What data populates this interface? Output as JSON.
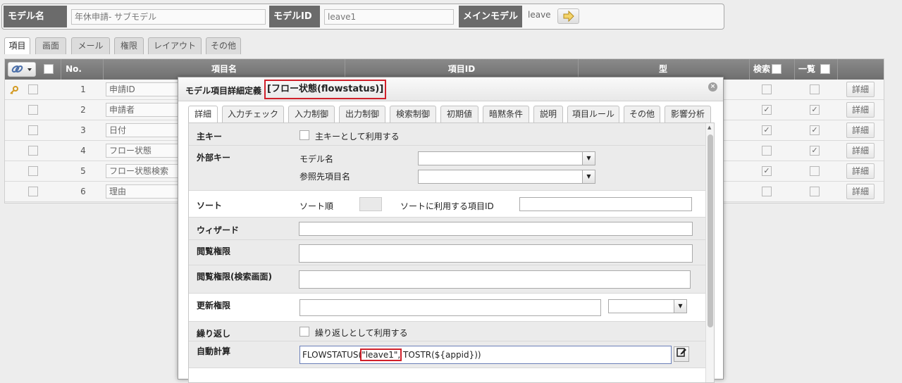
{
  "header": {
    "model_name_label": "モデル名",
    "model_name_value": "年休申請- サブモデル",
    "model_id_label": "モデルID",
    "model_id_value": "leave1",
    "main_model_label": "メインモデル",
    "main_model_value": "leave"
  },
  "tabs": [
    "項目",
    "画面",
    "メール",
    "権限",
    "レイアウト",
    "その他"
  ],
  "grid": {
    "headers": {
      "no": "No.",
      "name": "項目名",
      "id": "項目ID",
      "type": "型",
      "search": "検索",
      "list": "一覧"
    },
    "rows": [
      {
        "no": "1",
        "name": "申請ID",
        "search": false,
        "list": false,
        "key": true
      },
      {
        "no": "2",
        "name": "申請者",
        "search": true,
        "list": true,
        "key": false
      },
      {
        "no": "3",
        "name": "日付",
        "search": true,
        "list": true,
        "key": false
      },
      {
        "no": "4",
        "name": "フロー状態",
        "search": false,
        "list": true,
        "key": false
      },
      {
        "no": "5",
        "name": "フロー状態検索",
        "search": true,
        "list": false,
        "key": false
      },
      {
        "no": "6",
        "name": "理由",
        "search": false,
        "list": false,
        "key": false
      }
    ],
    "detail_label": "詳細",
    "check_mark": "✓"
  },
  "dialog": {
    "title": "モデル項目詳細定義",
    "field": "[フロー状態(flowstatus)]",
    "close_glyph": "×",
    "tabs": [
      "詳細",
      "入力チェック",
      "入力制御",
      "出力制御",
      "検索制御",
      "初期値",
      "暗黙条件",
      "説明",
      "項目ルール",
      "その他",
      "影響分析"
    ],
    "form": {
      "primary_key_label": "主キー",
      "primary_key_check": "主キーとして利用する",
      "foreign_key_label": "外部キー",
      "fk_model_label": "モデル名",
      "fk_item_label": "参照先項目名",
      "sort_label": "ソート",
      "sort_order_label": "ソート順",
      "sort_item_label": "ソートに利用する項目ID",
      "wizard_label": "ウィザード",
      "view_perm_label": "閲覧権限",
      "view_perm_search_label": "閲覧権限(検索画面)",
      "update_perm_label": "更新権限",
      "repeat_label": "繰り返し",
      "repeat_check": "繰り返しとして利用する",
      "auto_calc_label": "自動計算",
      "formula_prefix": "FLOWSTATUS(",
      "formula_highlight": "\"leave1\",",
      "formula_suffix": " TOSTR(${appid}))"
    }
  },
  "colors": {
    "accent_red": "#d0202a",
    "header_label_bg": "#6b6b6b"
  }
}
